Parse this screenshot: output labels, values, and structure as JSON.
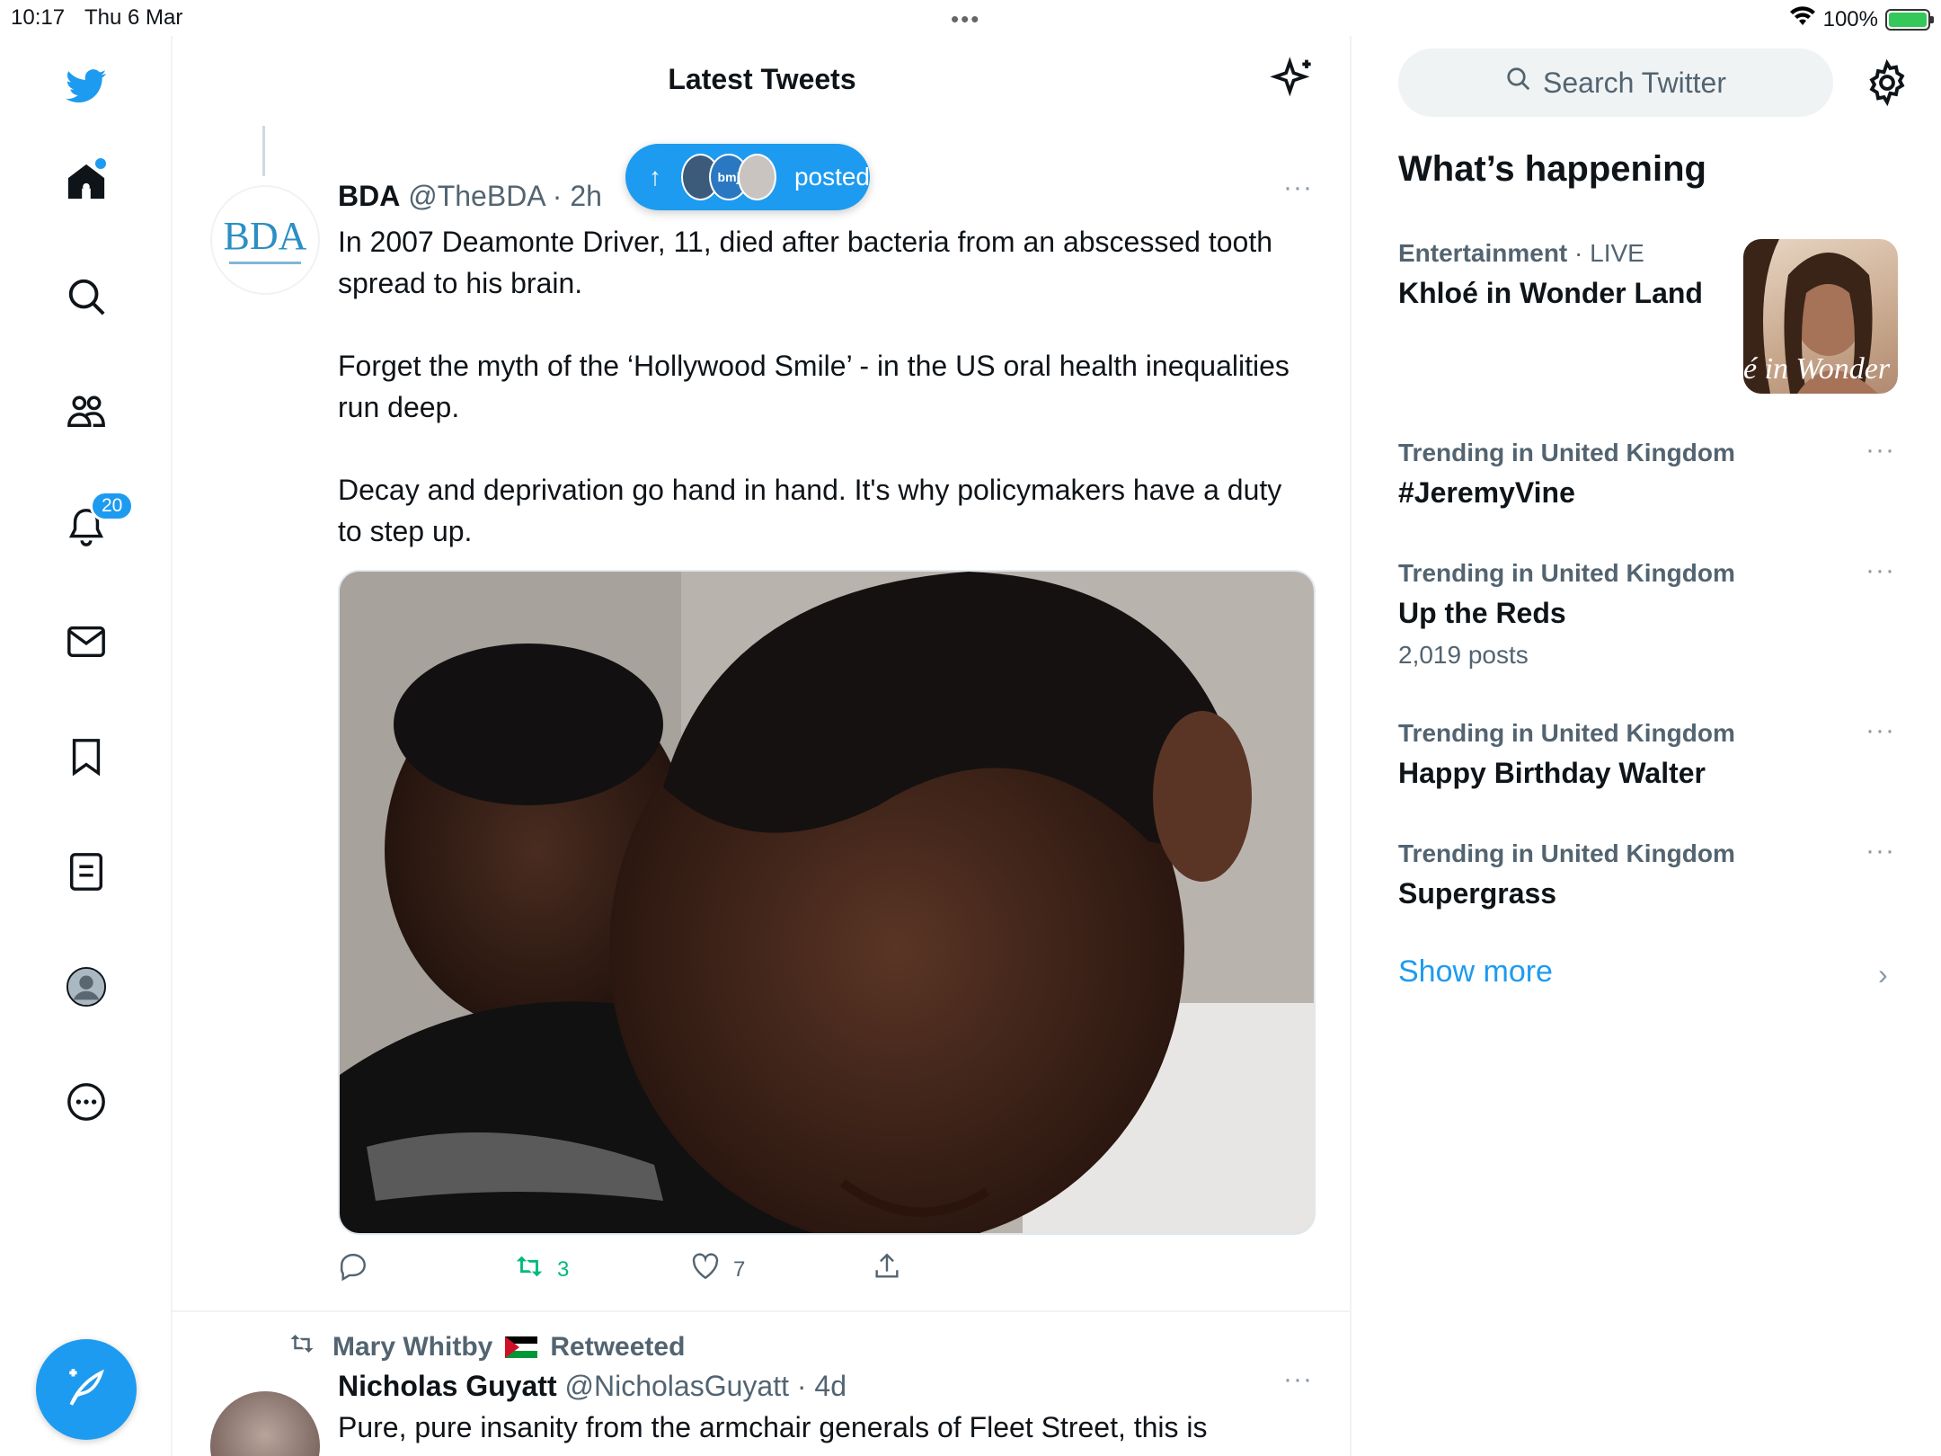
{
  "status_bar": {
    "time": "10:17",
    "date": "Thu 6 Mar",
    "battery": "100%",
    "dots": "•••"
  },
  "colors": {
    "accent": "#1d9bf0",
    "retweet": "#00ba7c",
    "muted": "#536471"
  },
  "nav": {
    "notifications_badge": "20",
    "items": [
      "twitter-logo",
      "home-icon",
      "search-icon",
      "communities-icon",
      "notifications-icon",
      "messages-icon",
      "bookmarks-icon",
      "lists-icon",
      "profile-icon",
      "more-icon"
    ]
  },
  "main": {
    "title": "Latest Tweets",
    "posted_pill": {
      "arrow": "↑",
      "label": "posted",
      "avatar_text": "bmj"
    },
    "tweet": {
      "avatar_text": "BDA",
      "name": "BDA",
      "handle": "@TheBDA",
      "time": "· 2h",
      "more": "···",
      "paragraphs": [
        "In 2007 Deamonte Driver, 11, died after bacteria from an abscessed tooth spread to his brain.",
        "Forget the myth of the ‘Hollywood Smile’ - in the US oral health inequalities run deep.",
        "Decay and deprivation go hand in hand. It's why policymakers have a duty to step up."
      ],
      "retweets": "3",
      "likes": "7"
    },
    "tweet2": {
      "retweeted_by": "Mary Whitby",
      "retweeted_label": "Retweeted",
      "name": "Nicholas Guyatt",
      "handle": "@NicholasGuyatt",
      "time": "· 4d",
      "more": "···",
      "text": "Pure, pure insanity from the armchair generals of Fleet Street, this is"
    }
  },
  "sidebar": {
    "search_placeholder": "Search Twitter",
    "section_title": "What’s happening",
    "featured": {
      "category": "Entertainment",
      "live": "· LIVE",
      "topic": "Khloé in Wonder Land",
      "image_script": "é in Wonder L"
    },
    "trends": [
      {
        "context": "Trending in United Kingdom",
        "topic": "#JeremyVine",
        "count": ""
      },
      {
        "context": "Trending in United Kingdom",
        "topic": "Up the Reds",
        "count": "2,019 posts"
      },
      {
        "context": "Trending in United Kingdom",
        "topic": "Happy Birthday Walter",
        "count": ""
      },
      {
        "context": "Trending in United Kingdom",
        "topic": "Supergrass",
        "count": ""
      }
    ],
    "trend_more": "···",
    "show_more": "Show more",
    "chevron": "›"
  }
}
